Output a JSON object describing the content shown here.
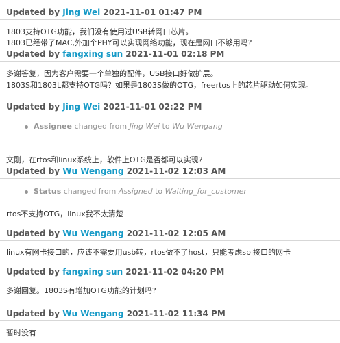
{
  "labels": {
    "updated_by": "Updated by",
    "changed_from": "changed from",
    "to": "to"
  },
  "entries": [
    {
      "author": "Jing Wei",
      "timestamp": "2021-11-01 01:47 PM",
      "notes": [
        "1803支持OTG功能，我们没有使用过USB转网口芯片。",
        "1803已经带了MAC,外加个PHY可以实现网络功能，现在是网口不够用吗?"
      ]
    },
    {
      "author": "fangxing sun",
      "timestamp": "2021-11-01 02:18 PM",
      "notes": [
        "多谢答复，因为客户需要一个单独的配件，USB接口好做扩展。",
        "1803S和1803L都支持OTG吗？如果是1803S做的OTG，freertos上的芯片驱动如何实现。"
      ]
    },
    {
      "author": "Jing Wei",
      "timestamp": "2021-11-01 02:22 PM",
      "details": [
        {
          "field": "Assignee",
          "from": "Jing Wei",
          "to": "Wu Wengang"
        }
      ],
      "notes": [
        "文刚，在rtos和linux系统上，软件上OTG是否都可以实现?"
      ]
    },
    {
      "author": "Wu Wengang",
      "timestamp": "2021-11-02 12:03 AM",
      "details": [
        {
          "field": "Status",
          "from": "Assigned",
          "to": "Waiting_for_customer"
        }
      ],
      "notes": [
        "rtos不支持OTG，linux我不太清楚"
      ]
    },
    {
      "author": "Wu Wengang",
      "timestamp": "2021-11-02 12:05 AM",
      "notes": [
        "linux有网卡接口的，应该不需要用usb转，rtos做不了host，只能考虑spi接口的网卡"
      ]
    },
    {
      "author": "fangxing sun",
      "timestamp": "2021-11-02 04:20 PM",
      "notes": [
        "多谢回复。1803S有增加OTG功能的计划吗?"
      ]
    },
    {
      "author": "Wu Wengang",
      "timestamp": "2021-11-02 11:34 PM",
      "notes": [
        "暂时没有"
      ]
    }
  ]
}
